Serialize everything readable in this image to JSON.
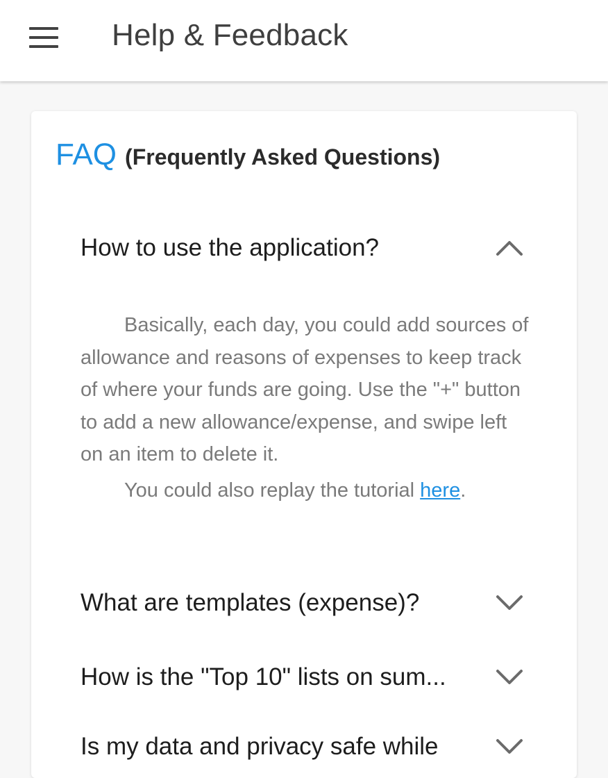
{
  "appbar": {
    "title": "Help & Feedback",
    "menu_icon": "hamburger-menu-icon"
  },
  "faq": {
    "title": "FAQ",
    "subtitle": "(Frequently Asked Questions)",
    "accent_color": "#1e90e2",
    "items": [
      {
        "question": "How to use the application?",
        "expanded": true,
        "icon": "chevron-up-icon",
        "answer_paragraph_1": "Basically, each day, you could add sources of allowance and reasons of expenses to keep track of where your funds are going. Use the \"+\" button to add a new allowance/expense, and swipe left on an item to delete it.",
        "answer_paragraph_2_prefix": "You could also replay the tutorial ",
        "answer_link_text": "here",
        "answer_paragraph_2_suffix": "."
      },
      {
        "question": "What are templates (expense)?",
        "expanded": false,
        "icon": "chevron-down-icon"
      },
      {
        "question": "How is the \"Top 10\" lists on sum...",
        "expanded": false,
        "icon": "chevron-down-icon"
      },
      {
        "question": "Is my data and privacy safe while",
        "expanded": false,
        "icon": "chevron-down-icon"
      }
    ]
  }
}
